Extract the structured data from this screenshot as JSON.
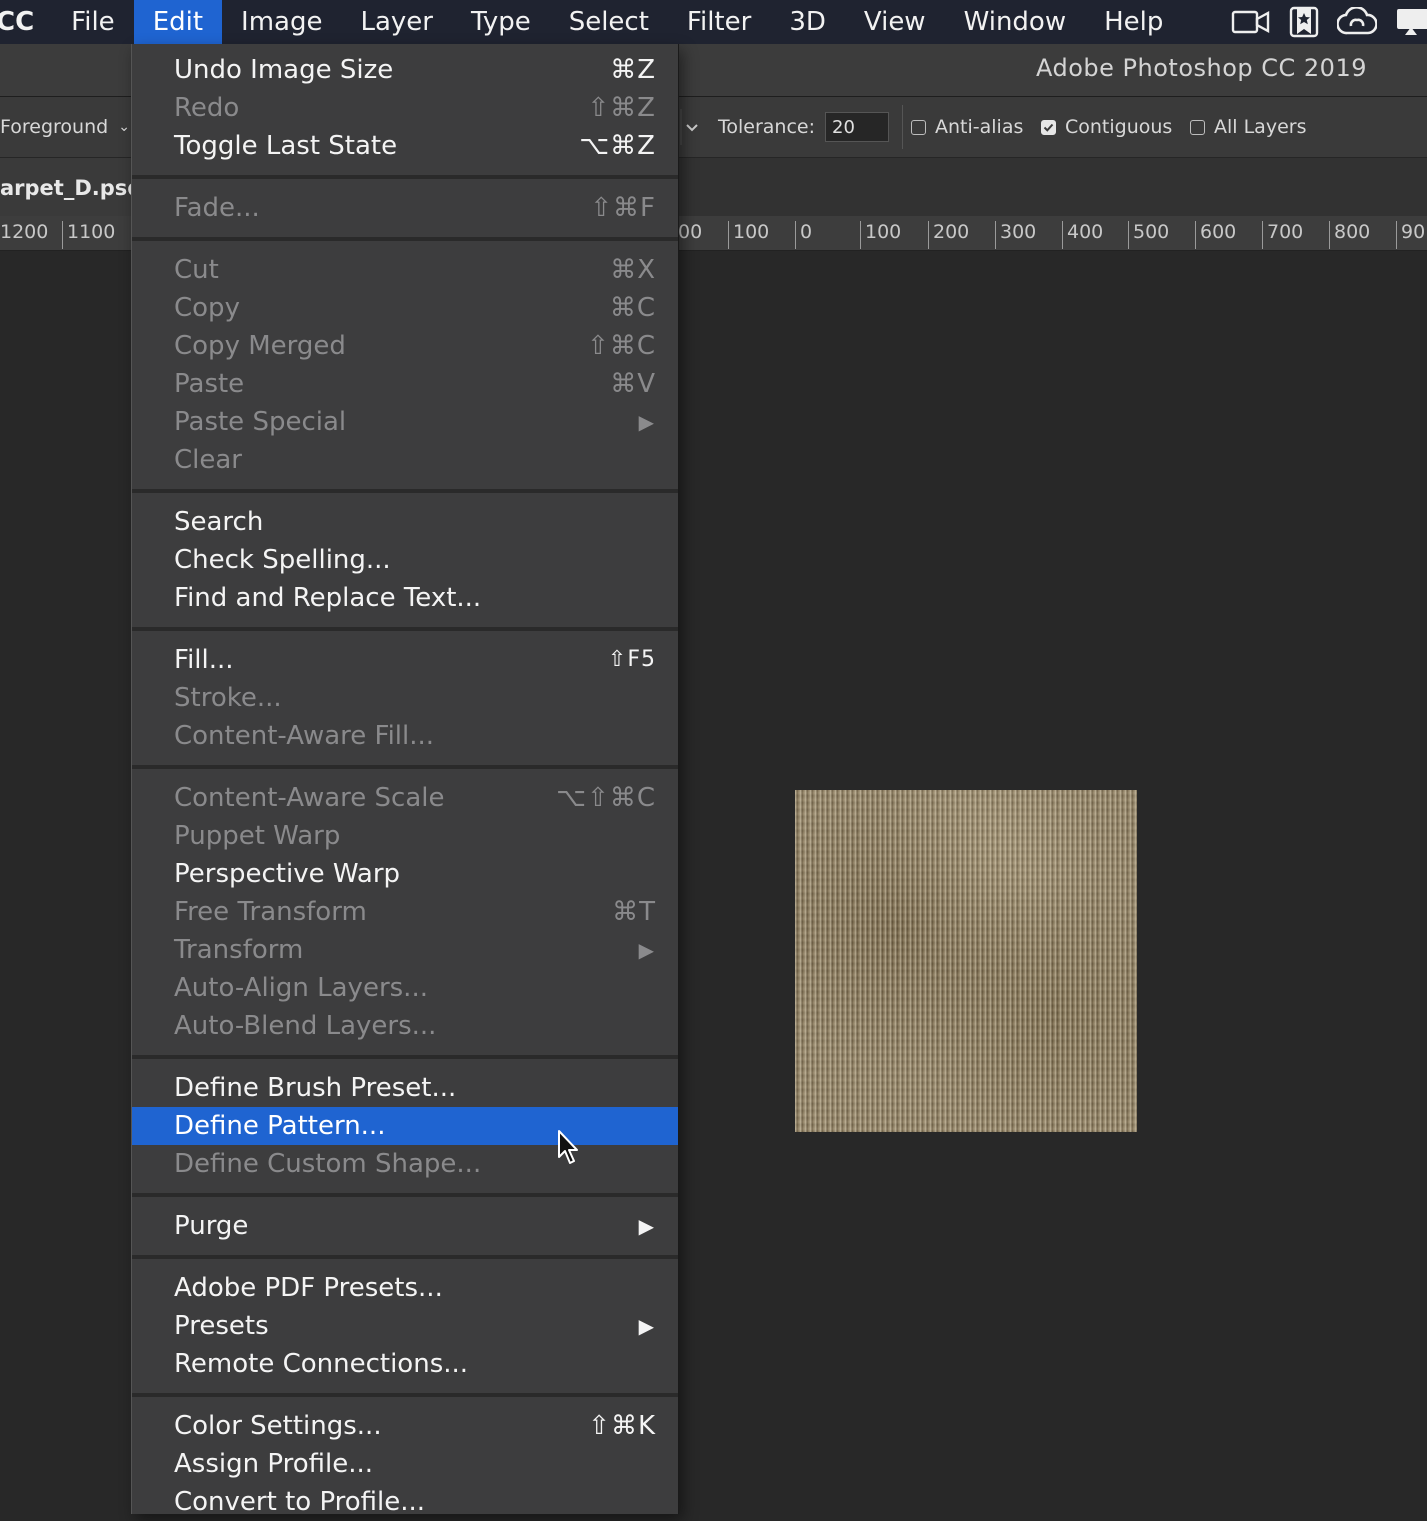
{
  "menubar": {
    "app": "CC",
    "items": [
      "File",
      "Edit",
      "Image",
      "Layer",
      "Type",
      "Select",
      "Filter",
      "3D",
      "View",
      "Window",
      "Help"
    ],
    "active_index": 1
  },
  "title_bar": {
    "title": "Adobe Photoshop CC 2019"
  },
  "options": {
    "fill_source": "Foreground",
    "tolerance_label": "Tolerance:",
    "tolerance_value": "20",
    "anti_alias_label": "Anti-alias",
    "anti_alias_checked": false,
    "contiguous_label": "Contiguous",
    "contiguous_checked": true,
    "all_layers_label": "All Layers",
    "all_layers_checked": false
  },
  "document": {
    "tab_title": "arpet_D.psd"
  },
  "ruler_labels": [
    "1200",
    "1100",
    "00",
    "100",
    "0",
    "100",
    "200",
    "300",
    "400",
    "500",
    "600",
    "700",
    "800",
    "90"
  ],
  "edit_menu": {
    "items": [
      {
        "label": "Undo Image Size",
        "shortcut": "⌘Z",
        "enabled": true
      },
      {
        "label": "Redo",
        "shortcut": "⇧⌘Z",
        "enabled": false
      },
      {
        "label": "Toggle Last State",
        "shortcut": "⌥⌘Z",
        "enabled": true
      },
      {
        "label": "Fade...",
        "shortcut": "⇧⌘F",
        "enabled": false
      },
      {
        "label": "Cut",
        "shortcut": "⌘X",
        "enabled": false
      },
      {
        "label": "Copy",
        "shortcut": "⌘C",
        "enabled": false
      },
      {
        "label": "Copy Merged",
        "shortcut": "⇧⌘C",
        "enabled": false
      },
      {
        "label": "Paste",
        "shortcut": "⌘V",
        "enabled": false
      },
      {
        "label": "Paste Special",
        "submenu": true,
        "enabled": false
      },
      {
        "label": "Clear",
        "enabled": false
      },
      {
        "label": "Search",
        "enabled": true
      },
      {
        "label": "Check Spelling...",
        "enabled": true
      },
      {
        "label": "Find and Replace Text...",
        "enabled": true
      },
      {
        "label": "Fill...",
        "shortcut": "⇧F5",
        "enabled": true
      },
      {
        "label": "Stroke...",
        "enabled": false
      },
      {
        "label": "Content-Aware Fill...",
        "enabled": false
      },
      {
        "label": "Content-Aware Scale",
        "shortcut": "⌥⇧⌘C",
        "enabled": false
      },
      {
        "label": "Puppet Warp",
        "enabled": false
      },
      {
        "label": "Perspective Warp",
        "enabled": true
      },
      {
        "label": "Free Transform",
        "shortcut": "⌘T",
        "enabled": false
      },
      {
        "label": "Transform",
        "submenu": true,
        "enabled": false
      },
      {
        "label": "Auto-Align Layers...",
        "enabled": false
      },
      {
        "label": "Auto-Blend Layers...",
        "enabled": false
      },
      {
        "label": "Define Brush Preset...",
        "enabled": true
      },
      {
        "label": "Define Pattern...",
        "enabled": true,
        "highlighted": true
      },
      {
        "label": "Define Custom Shape...",
        "enabled": false
      },
      {
        "label": "Purge",
        "submenu": true,
        "enabled": true
      },
      {
        "label": "Adobe PDF Presets...",
        "enabled": true
      },
      {
        "label": "Presets",
        "submenu": true,
        "enabled": true
      },
      {
        "label": "Remote Connections...",
        "enabled": true
      },
      {
        "label": "Color Settings...",
        "shortcut": "⇧⌘K",
        "enabled": true
      },
      {
        "label": "Assign Profile...",
        "enabled": true
      },
      {
        "label": "Convert to Profile...",
        "enabled": true
      }
    ]
  },
  "colors": {
    "menubar_bg": "#1f2330",
    "highlight": "#1f64d1",
    "menu_bg": "#3d3d3e",
    "workspace_bg": "#282828"
  }
}
